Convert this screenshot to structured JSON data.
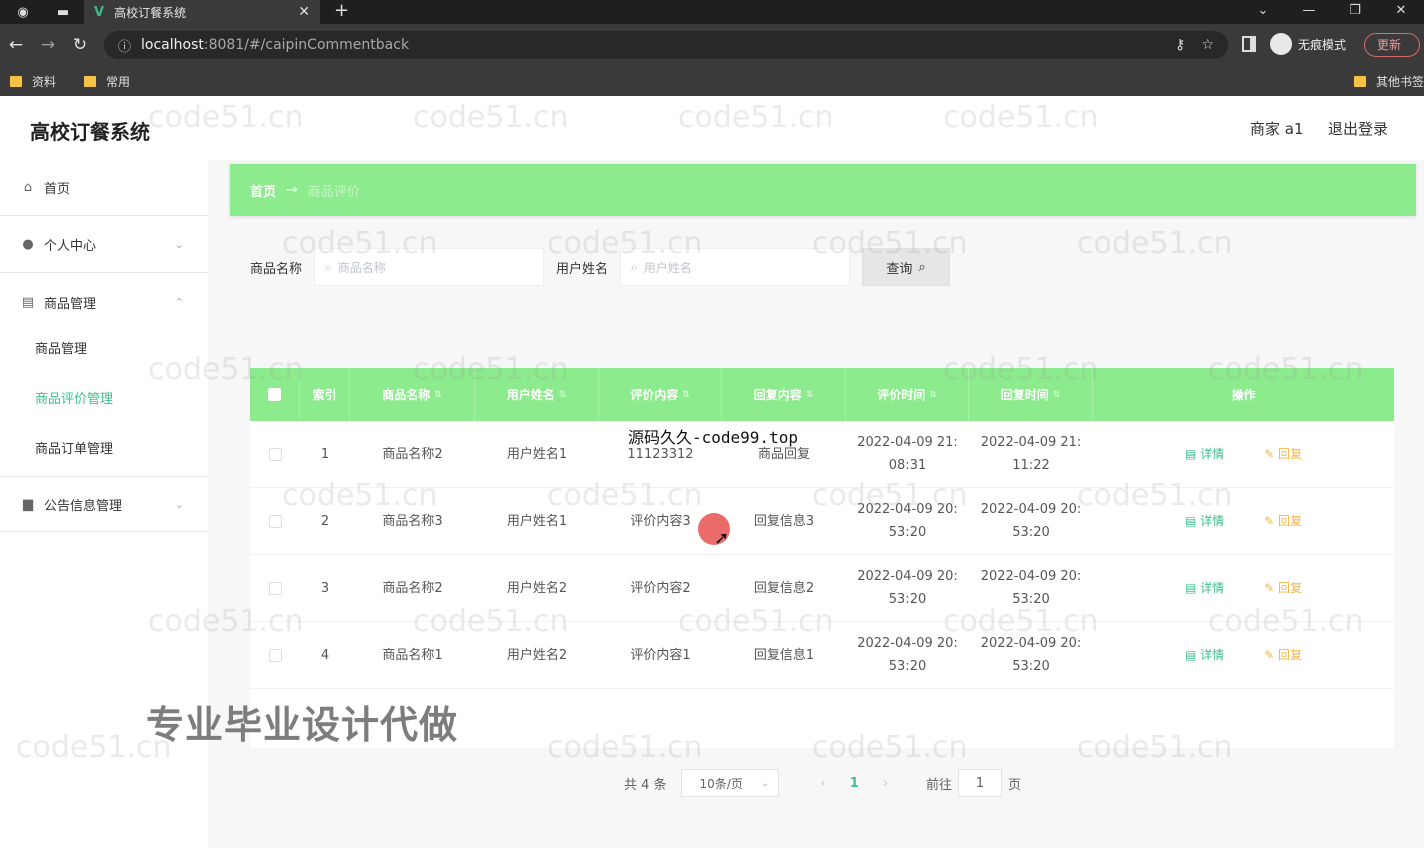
{
  "browser": {
    "tab_title": "高校订餐系统",
    "url_host": "localhost",
    "url_rest": ":8081/#/caipinCommentback",
    "incognito_label": "无痕模式",
    "update_label": "更新",
    "bookmarks": [
      "资料",
      "常用"
    ],
    "other_bookmarks": "其他书签"
  },
  "app": {
    "title": "高校订餐系统",
    "user": "商家 a1",
    "logout": "退出登录"
  },
  "sidebar": {
    "home": "首页",
    "personal": "个人中心",
    "goods_mgmt": "商品管理",
    "sub_goods": "商品管理",
    "sub_review": "商品评价管理",
    "sub_order": "商品订单管理",
    "notice": "公告信息管理"
  },
  "breadcrumb": {
    "home": "首页",
    "sep": "→",
    "current": "商品评价"
  },
  "search": {
    "goods_label": "商品名称",
    "goods_placeholder": "商品名称",
    "user_label": "用户姓名",
    "user_placeholder": "用户姓名",
    "query": "查询"
  },
  "table": {
    "headers": {
      "index": "索引",
      "goods": "商品名称",
      "user": "用户姓名",
      "content": "评价内容",
      "reply": "回复内容",
      "review_time": "评价时间",
      "reply_time": "回复时间",
      "ops": "操作"
    },
    "detail": "详情",
    "reply_btn": "回复",
    "rows": [
      {
        "index": "1",
        "goods": "商品名称2",
        "user": "用户姓名1",
        "content": "11123312",
        "reply": "商品回复",
        "rt1": "2022-04-09 21:",
        "rt2": "08:31",
        "pt1": "2022-04-09 21:",
        "pt2": "11:22"
      },
      {
        "index": "2",
        "goods": "商品名称3",
        "user": "用户姓名1",
        "content": "评价内容3",
        "reply": "回复信息3",
        "rt1": "2022-04-09 20:",
        "rt2": "53:20",
        "pt1": "2022-04-09 20:",
        "pt2": "53:20"
      },
      {
        "index": "3",
        "goods": "商品名称2",
        "user": "用户姓名2",
        "content": "评价内容2",
        "reply": "回复信息2",
        "rt1": "2022-04-09 20:",
        "rt2": "53:20",
        "pt1": "2022-04-09 20:",
        "pt2": "53:20"
      },
      {
        "index": "4",
        "goods": "商品名称1",
        "user": "用户姓名2",
        "content": "评价内容1",
        "reply": "回复信息1",
        "rt1": "2022-04-09 20:",
        "rt2": "53:20",
        "pt1": "2022-04-09 20:",
        "pt2": "53:20"
      }
    ]
  },
  "pager": {
    "total": "共 4 条",
    "page_size": "10条/页",
    "current": "1",
    "goto_label": "前往",
    "goto_value": "1",
    "page_unit": "页"
  },
  "overlay": {
    "site_text": "源码久久-code99.top",
    "ad_text": "专业毕业设计代做",
    "watermark": "code51.cn"
  }
}
